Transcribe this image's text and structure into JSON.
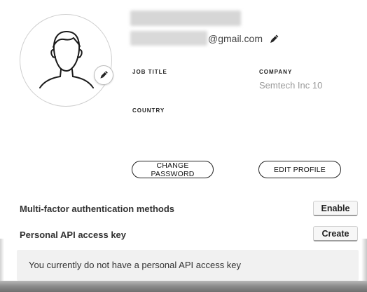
{
  "profile": {
    "email_domain": "@gmail.com",
    "avatar_icon": "user-silhouette-icon",
    "edit_icon": "pencil-icon"
  },
  "fields": {
    "job_title_label": "JOB TITLE",
    "job_title_value": "",
    "company_label": "COMPANY",
    "company_value": "Semtech Inc 10",
    "country_label": "COUNTRY",
    "country_value": ""
  },
  "actions": {
    "change_password": "CHANGE PASSWORD",
    "edit_profile": "EDIT PROFILE"
  },
  "security": {
    "mfa_label": "Multi-factor authentication methods",
    "mfa_button": "Enable",
    "api_key_label": "Personal API access key",
    "api_key_button": "Create",
    "api_key_notice": "You currently do not have a personal API access key"
  },
  "colors": {
    "muted_text": "#9a9a9a",
    "notice_background": "#f1f1f1",
    "outline": "#222222"
  }
}
